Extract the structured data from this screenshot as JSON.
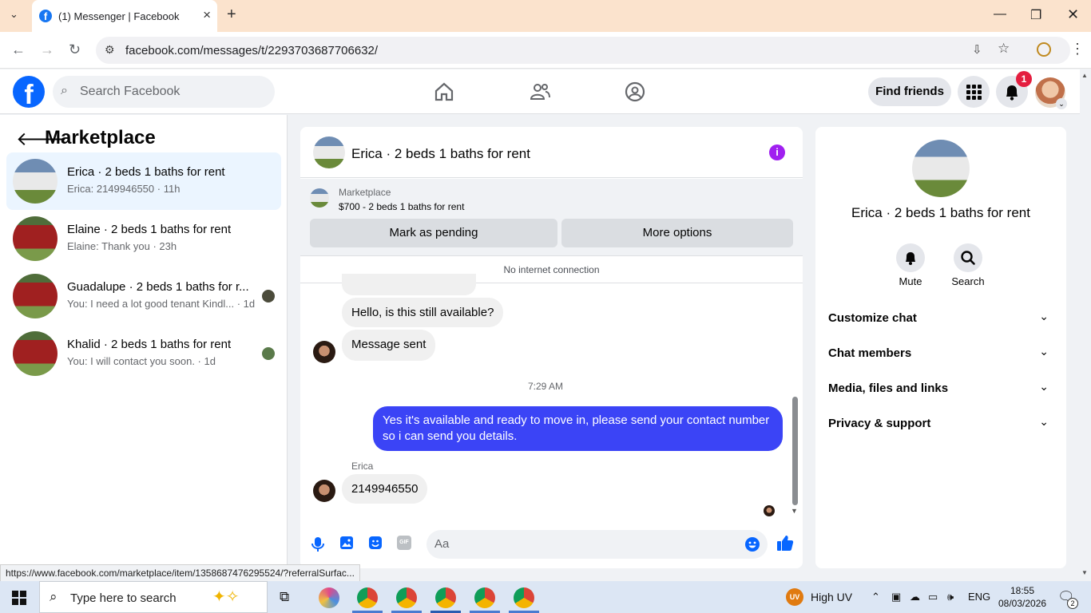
{
  "browser": {
    "tab_title": "(1) Messenger | Facebook",
    "url": "facebook.com/messages/t/2293703687706632/",
    "status_url": "https://www.facebook.com/marketplace/item/1358687476295524/?referralSurfac..."
  },
  "header": {
    "search_placeholder": "Search Facebook",
    "find_friends": "Find friends",
    "notification_count": "1"
  },
  "sidebar": {
    "title": "Marketplace",
    "conversations": [
      {
        "name": "Erica · 2 beds 1 baths for rent",
        "preview": "Erica: 2149946550 · 11h",
        "active": true
      },
      {
        "name": "Elaine · 2 beds 1 baths for rent",
        "preview": "Elaine: Thank you · 23h"
      },
      {
        "name": "Guadalupe · 2 beds 1 baths for r...",
        "preview": "You: I need a lot good tenant Kindl... · 1d"
      },
      {
        "name": "Khalid · 2 beds 1 baths for rent",
        "preview": "You: I will contact you soon. · 1d"
      }
    ]
  },
  "chat": {
    "title": "Erica · 2 beds 1 baths for rent",
    "marketplace_label": "Marketplace",
    "listing": "$700 - 2 beds 1 baths for rent",
    "mark_pending": "Mark as pending",
    "more_options": "More options",
    "no_connection": "No internet connection",
    "messages": {
      "m1": "Hello, is this still available?",
      "m2": "Message sent",
      "timestamp": "7:29 AM",
      "m3": "Yes it's available and ready to move in, please send your contact number so i can send you details.",
      "sender": "Erica",
      "m4": "2149946550"
    },
    "composer_placeholder": "Aa"
  },
  "details": {
    "title": "Erica · 2 beds 1 baths for rent",
    "mute": "Mute",
    "search": "Search",
    "sections": [
      "Customize chat",
      "Chat members",
      "Media, files and links",
      "Privacy & support"
    ]
  },
  "taskbar": {
    "search_placeholder": "Type here to search",
    "weather": "High UV",
    "uv_badge": "UV",
    "language": "ENG",
    "time": "18:55",
    "date": "08/03/2026",
    "notification_count": "2"
  },
  "colors": {
    "accent": "#0866ff",
    "outgoing_bubble": "#3b44f6",
    "info_icon": "#a020f0",
    "badge": "#e41e3f"
  }
}
